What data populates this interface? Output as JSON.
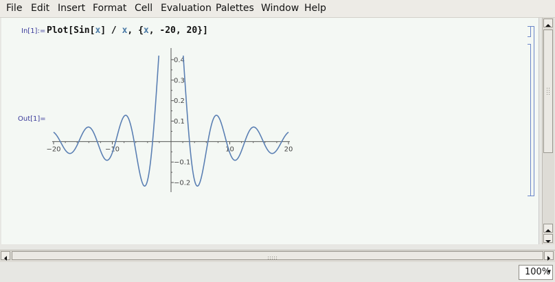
{
  "menu": [
    "File",
    "Edit",
    "Insert",
    "Format",
    "Cell",
    "Evaluation",
    "Palettes",
    "Window",
    "Help"
  ],
  "cell": {
    "in_label": "In[1]:=",
    "out_label": "Out[1]=",
    "code_head": "Plot[Sin[",
    "code_x1": "x",
    "code_mid": "] / ",
    "code_x2": "x",
    "code_sep": ", {",
    "code_x3": "x",
    "code_tail": ", -20, 20}]"
  },
  "status": {
    "zoom": "100%"
  },
  "colors": {
    "curve": "#5a7fb3",
    "label": "#3a3a9a",
    "symbol": "#4b7aa6",
    "background": "#f4f8f4"
  },
  "chart_data": {
    "type": "line",
    "function": "Sin[x]/x",
    "xlim": [
      -20,
      20
    ],
    "ylim": [
      -0.22,
      0.43
    ],
    "x_ticks": [
      -20,
      -10,
      10,
      20
    ],
    "x_tick_labels": [
      "-20",
      "-10",
      "10",
      "20"
    ],
    "y_ticks": [
      -0.2,
      -0.1,
      0.1,
      0.2,
      0.3,
      0.4
    ],
    "y_tick_labels": [
      "-0.2",
      "-0.1",
      "0.1",
      "0.2",
      "0.3",
      "0.4"
    ],
    "series": [
      {
        "x": [
          -20,
          -19,
          -18,
          -17,
          -16,
          -15,
          -14,
          -13,
          -12,
          -11,
          -10,
          -9,
          -8,
          -7,
          -6,
          -5,
          -4,
          -3,
          -2.4,
          -2.3,
          2.3,
          2.4,
          3,
          4,
          5,
          6,
          7,
          8,
          9,
          10,
          11,
          12,
          13,
          14,
          15,
          16,
          17,
          18,
          19,
          20
        ],
        "y": [
          0.046,
          0.008,
          -0.042,
          -0.056,
          -0.018,
          0.043,
          0.071,
          0.032,
          -0.045,
          -0.091,
          -0.054,
          0.046,
          0.124,
          0.094,
          -0.047,
          -0.192,
          -0.189,
          0.047,
          0.28,
          0.32,
          0.32,
          0.28,
          0.047,
          -0.189,
          -0.192,
          -0.047,
          0.094,
          0.124,
          0.046,
          -0.054,
          -0.091,
          -0.045,
          0.032,
          0.071,
          0.043,
          -0.018,
          -0.056,
          -0.042,
          0.008,
          0.046
        ]
      }
    ]
  }
}
